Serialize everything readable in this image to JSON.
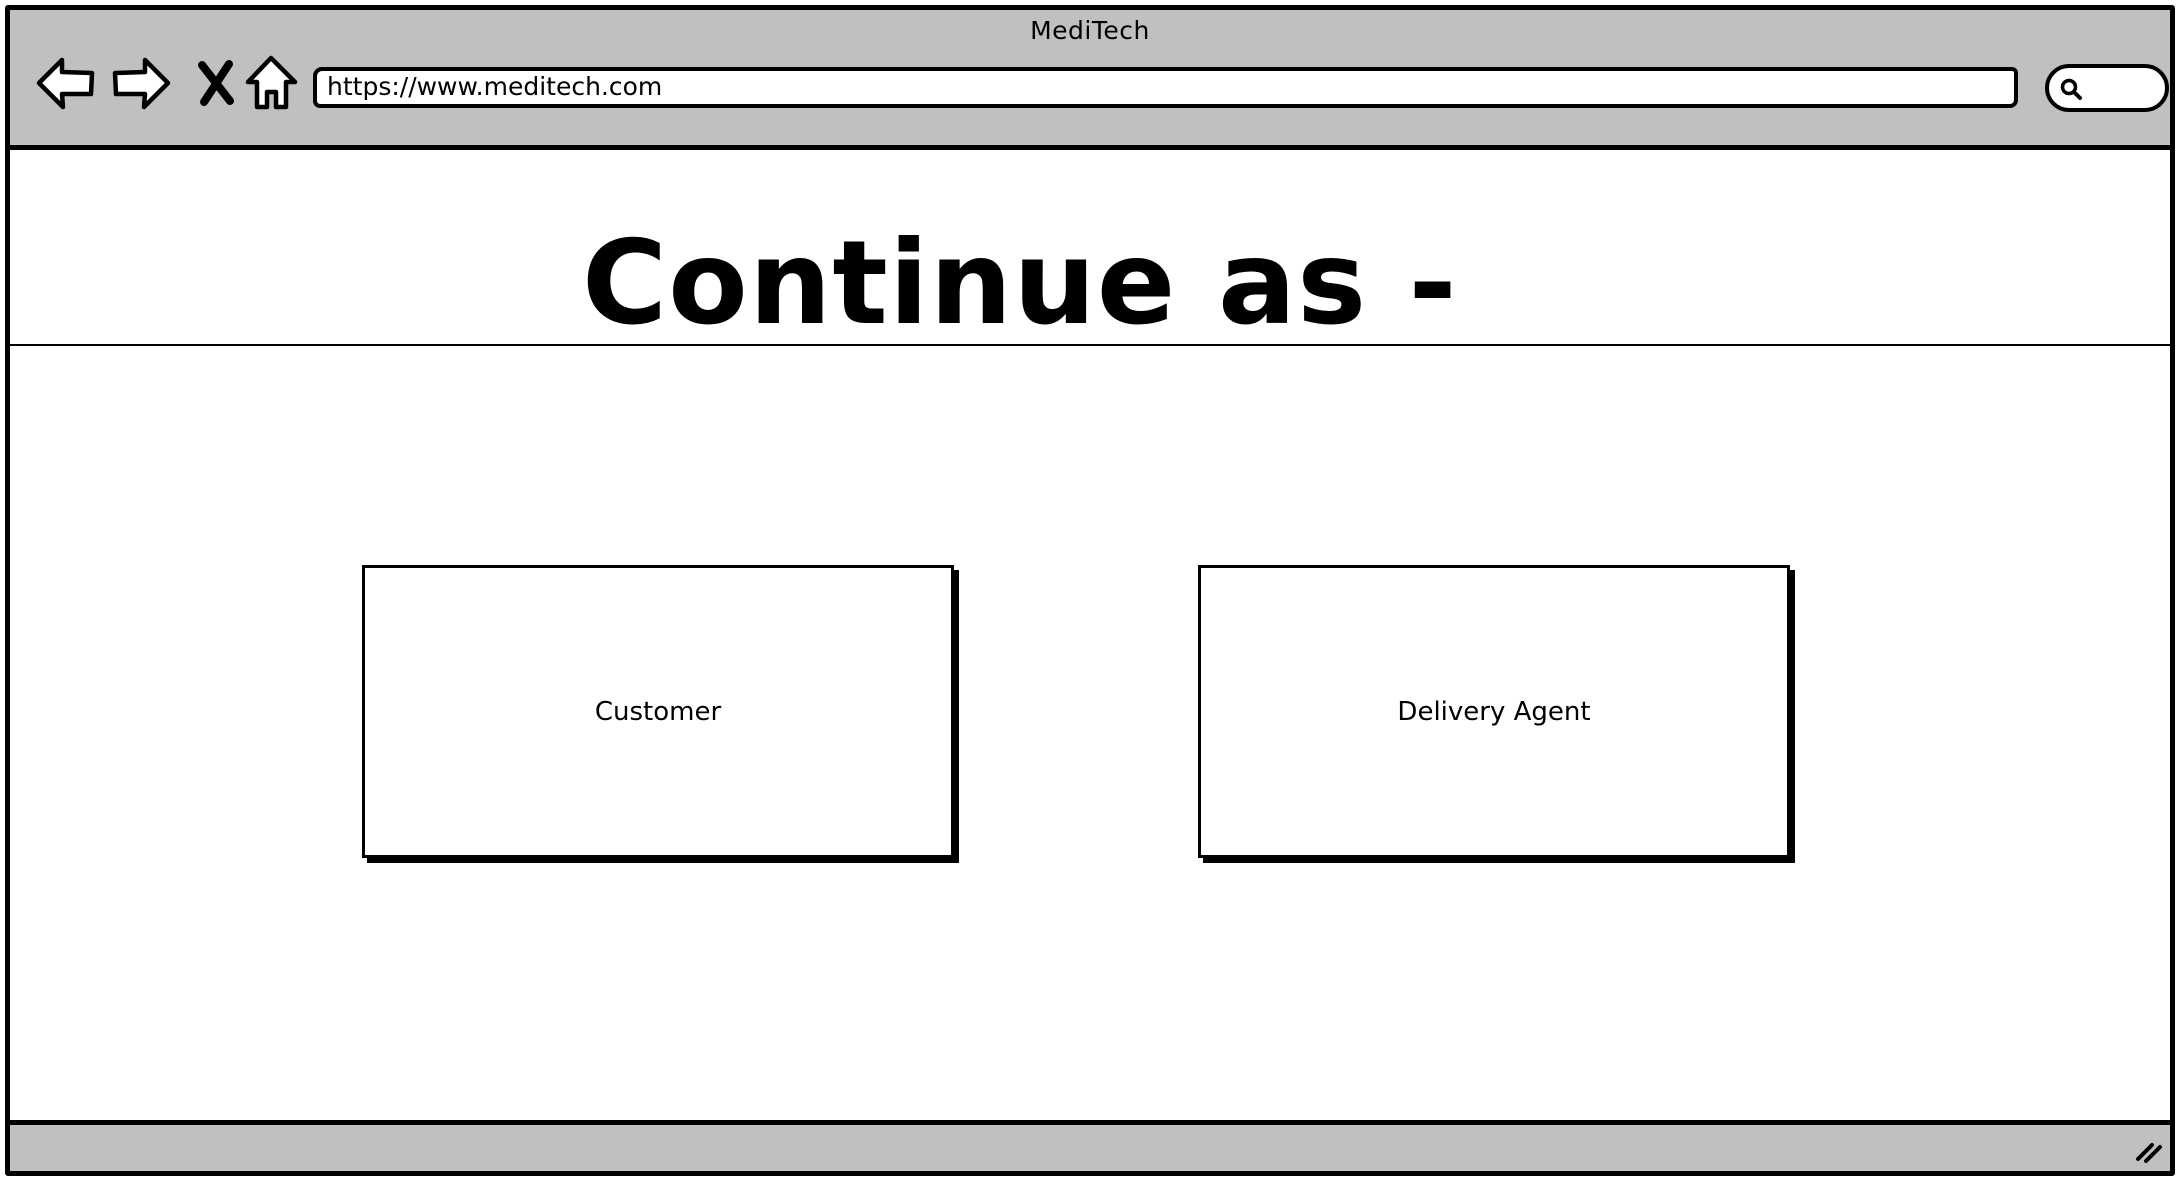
{
  "browser": {
    "window_title": "MediTech",
    "url": "https://www.meditech.com",
    "icons": {
      "back": "back-arrow-icon",
      "forward": "forward-arrow-icon",
      "stop": "close-icon",
      "home": "home-icon",
      "search": "search-icon",
      "resize": "resize-grip-icon"
    },
    "colors": {
      "chrome": "#c0c0c0",
      "stroke": "#000000",
      "page": "#ffffff"
    }
  },
  "page": {
    "heading": "Continue as -",
    "options": [
      {
        "label": "Customer"
      },
      {
        "label": "Delivery Agent"
      }
    ]
  }
}
